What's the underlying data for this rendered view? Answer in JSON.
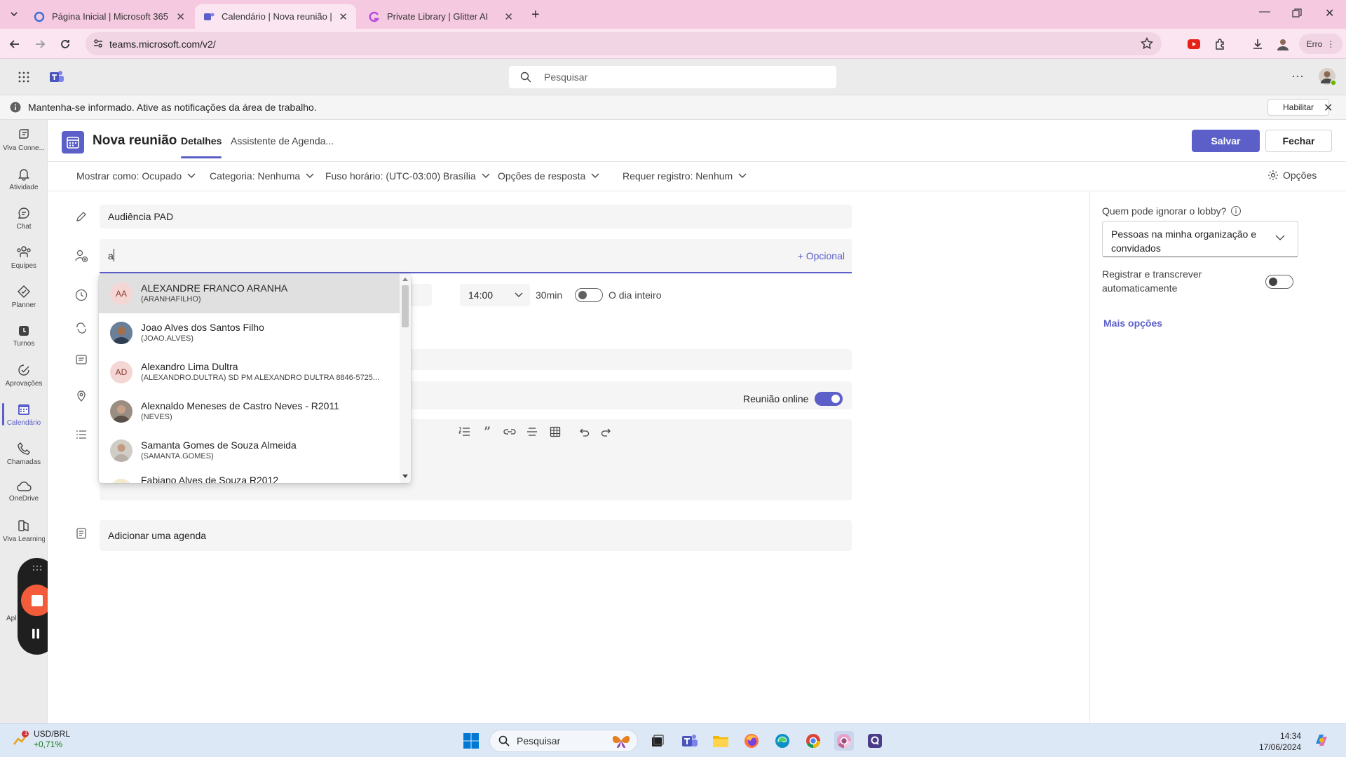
{
  "browser": {
    "tabs": [
      {
        "label": "Página Inicial | Microsoft 365"
      },
      {
        "label": "Calendário | Nova reunião | Mic"
      },
      {
        "label": "Private Library | Glitter AI"
      }
    ],
    "url": "teams.microsoft.com/v2/",
    "profile_label": "Erro"
  },
  "teams": {
    "search_placeholder": "Pesquisar"
  },
  "notification": {
    "text": "Mantenha-se informado. Ative as notificações da área de trabalho.",
    "button": "Habilitar"
  },
  "rail": {
    "items": [
      {
        "label": "Viva Conne...",
        "icon": "viva-connections-icon"
      },
      {
        "label": "Atividade",
        "icon": "bell-icon"
      },
      {
        "label": "Chat",
        "icon": "chat-icon"
      },
      {
        "label": "Equipes",
        "icon": "teams-icon"
      },
      {
        "label": "Planner",
        "icon": "planner-icon"
      },
      {
        "label": "Turnos",
        "icon": "shifts-icon"
      },
      {
        "label": "Aprovações",
        "icon": "approvals-icon"
      },
      {
        "label": "Calendário",
        "icon": "calendar-icon"
      },
      {
        "label": "Chamadas",
        "icon": "phone-icon"
      },
      {
        "label": "OneDrive",
        "icon": "cloud-icon"
      },
      {
        "label": "Viva Learning",
        "icon": "learning-icon"
      }
    ],
    "apps_partial": "Apl"
  },
  "meeting": {
    "title": "Nova reunião",
    "tabs": [
      "Detalhes",
      "Assistente de Agenda..."
    ],
    "save": "Salvar",
    "close": "Fechar",
    "options": [
      "Mostrar como: Ocupado",
      "Categoria: Nenhuma",
      "Fuso horário: (UTC-03:00) Brasília",
      "Opções de resposta",
      "Requer registro: Nenhum"
    ],
    "options_button": "Opções",
    "title_value": "Audiência PAD",
    "attendee_input": "a",
    "optional": "+ Opcional",
    "start_time": "14:00",
    "duration": "30min",
    "all_day": "O dia inteiro",
    "online_label": "Reunião online",
    "agenda_placeholder": "Adicionar uma agenda"
  },
  "right_panel": {
    "lobby_label": "Quem pode ignorar o lobby?",
    "lobby_value": "Pessoas na minha organização e convidados",
    "record_label": "Registrar e transcrever automaticamente",
    "more_options": "Mais opções"
  },
  "people": [
    {
      "name": "ALEXANDRE FRANCO ARANHA",
      "mail": "(ARANHAFILHO)",
      "initials": "AA"
    },
    {
      "name": "Joao Alves dos Santos Filho",
      "mail": "(JOAO.ALVES)",
      "initials": ""
    },
    {
      "name": "Alexandro Lima Dultra",
      "mail": "(ALEXANDRO.DULTRA) SD PM ALEXANDRO DULTRA 8846-5725...",
      "initials": "AD"
    },
    {
      "name": "Alexnaldo Meneses de Castro Neves - R2011",
      "mail": "(NEVES)",
      "initials": ""
    },
    {
      "name": "Samanta Gomes de Souza Almeida",
      "mail": "(SAMANTA.GOMES)",
      "initials": ""
    },
    {
      "name": "Fabiano Alves de Souza R2012",
      "mail": "",
      "initials": ""
    }
  ],
  "taskbar": {
    "weather_title": "USD/BRL",
    "weather_value": "+0,71%",
    "badge": "1",
    "search_placeholder": "Pesquisar",
    "time": "14:34",
    "date": "17/06/2024"
  },
  "colors": {
    "accent": "#5b5fc7",
    "tabbar": "#f5c9e0",
    "recorder_stop": "#f25c3b"
  }
}
